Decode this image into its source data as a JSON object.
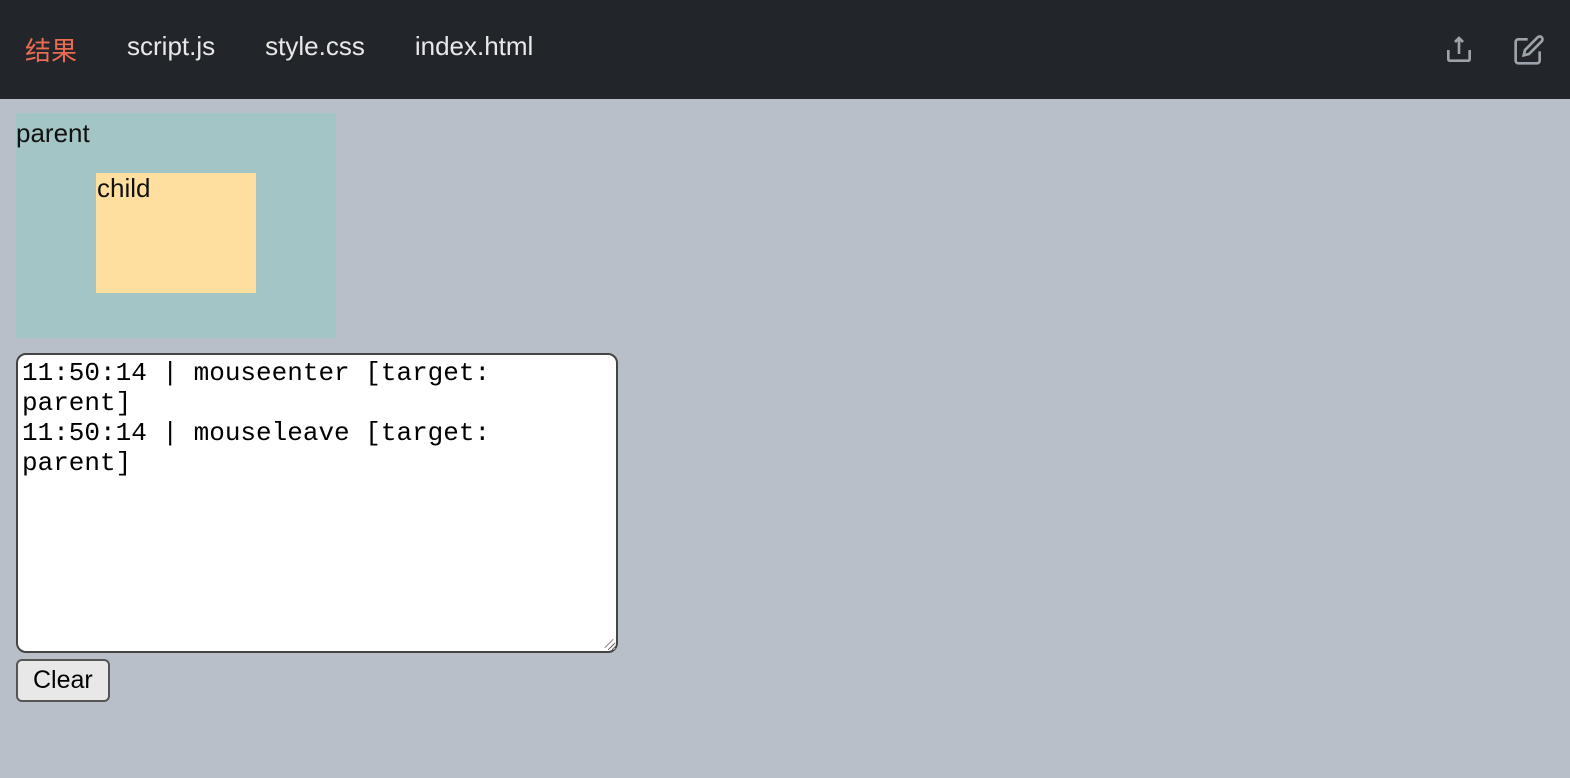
{
  "tabs": [
    {
      "label": "结果",
      "active": true
    },
    {
      "label": "script.js",
      "active": false
    },
    {
      "label": "style.css",
      "active": false
    },
    {
      "label": "index.html",
      "active": false
    }
  ],
  "demo": {
    "parent_label": "parent",
    "child_label": "child"
  },
  "log": {
    "text": "11:50:14 | mouseenter [target: parent]\n11:50:14 | mouseleave [target: parent]"
  },
  "buttons": {
    "clear": "Clear"
  },
  "icons": {
    "share": "share-icon",
    "edit": "edit-icon"
  }
}
